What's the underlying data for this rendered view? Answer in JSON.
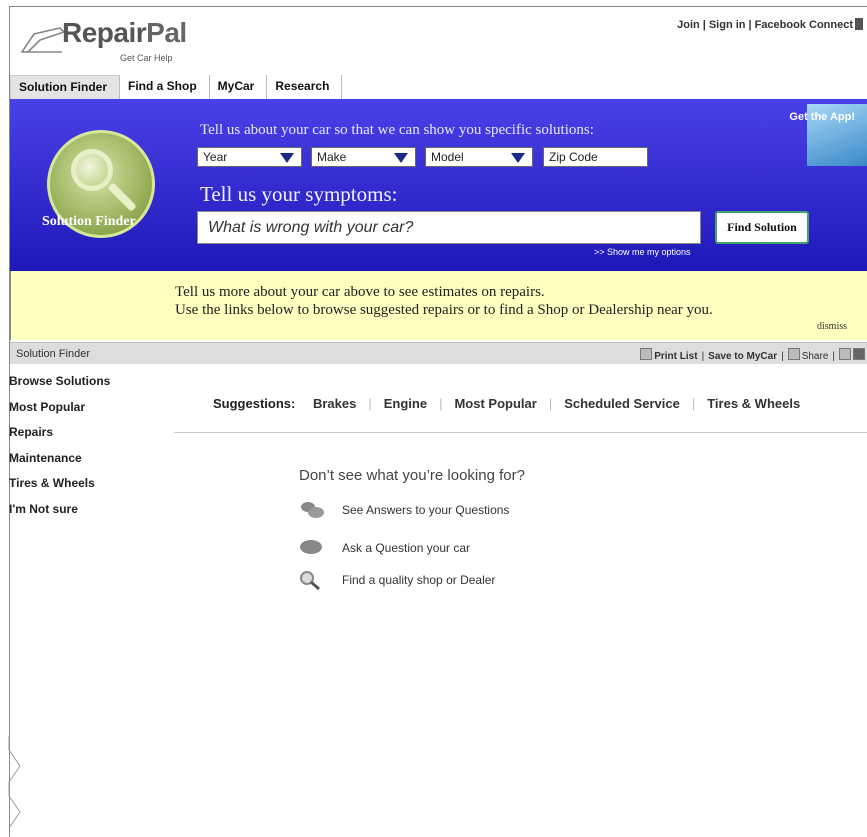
{
  "logo": {
    "brand_a": "Repair",
    "brand_b": "Pal",
    "tagline": "Get Car Help"
  },
  "top_links": {
    "join": "Join",
    "signin": "Sign in",
    "facebook": "Facebook Connect",
    "sep": "|"
  },
  "tabs": [
    {
      "label": "Solution Finder"
    },
    {
      "label": "Find a Shop"
    },
    {
      "label": "MyCar"
    },
    {
      "label": "Research"
    }
  ],
  "banner": {
    "intro": "Tell us about your car so that we can show you specific solutions:",
    "year": "Year",
    "make": "Make",
    "model": "Model",
    "zip_placeholder": "Zip Code",
    "symptoms_title": "Tell us your symptoms:",
    "symptom_placeholder": "What is wrong with your car?",
    "find_button": "Find Solution",
    "options_link": ">> Show me my options",
    "solution_finder_label": "Solution Finder",
    "app_label": "Get the App!"
  },
  "notice": {
    "line1": "Tell us more about your car above to see estimates on repairs.",
    "line2": "Use the links below to browse suggested repairs or to find a Shop or Dealership near you.",
    "dismiss": "dismiss"
  },
  "graybar": {
    "title": "Solution Finder",
    "print": "Print List",
    "save": "Save to MyCar",
    "share": "Share",
    "sep": "|"
  },
  "sidebar": [
    "Browse Solutions",
    "Most Popular",
    "Repairs",
    "Maintenance",
    "Tires & Wheels",
    "I'm Not sure"
  ],
  "suggestions": {
    "label": "Suggestions:",
    "items": [
      "Brakes",
      "Engine",
      "Most Popular",
      "Scheduled Service",
      "Tires & Wheels"
    ],
    "sep": "|"
  },
  "more": {
    "title": "Don’t see what you’re looking for?",
    "rows": [
      {
        "icon": "answers-bubbles-icon",
        "text": "See Answers to your Questions"
      },
      {
        "icon": "question-bubble-icon",
        "text": "Ask a Question your car"
      },
      {
        "icon": "magnifier-icon",
        "text": "Find a quality shop or Dealer"
      }
    ]
  },
  "colors": {
    "banner_blue": "#2a22d0",
    "notice_yellow": "#ffffc0",
    "button_border": "#3fa36a"
  }
}
